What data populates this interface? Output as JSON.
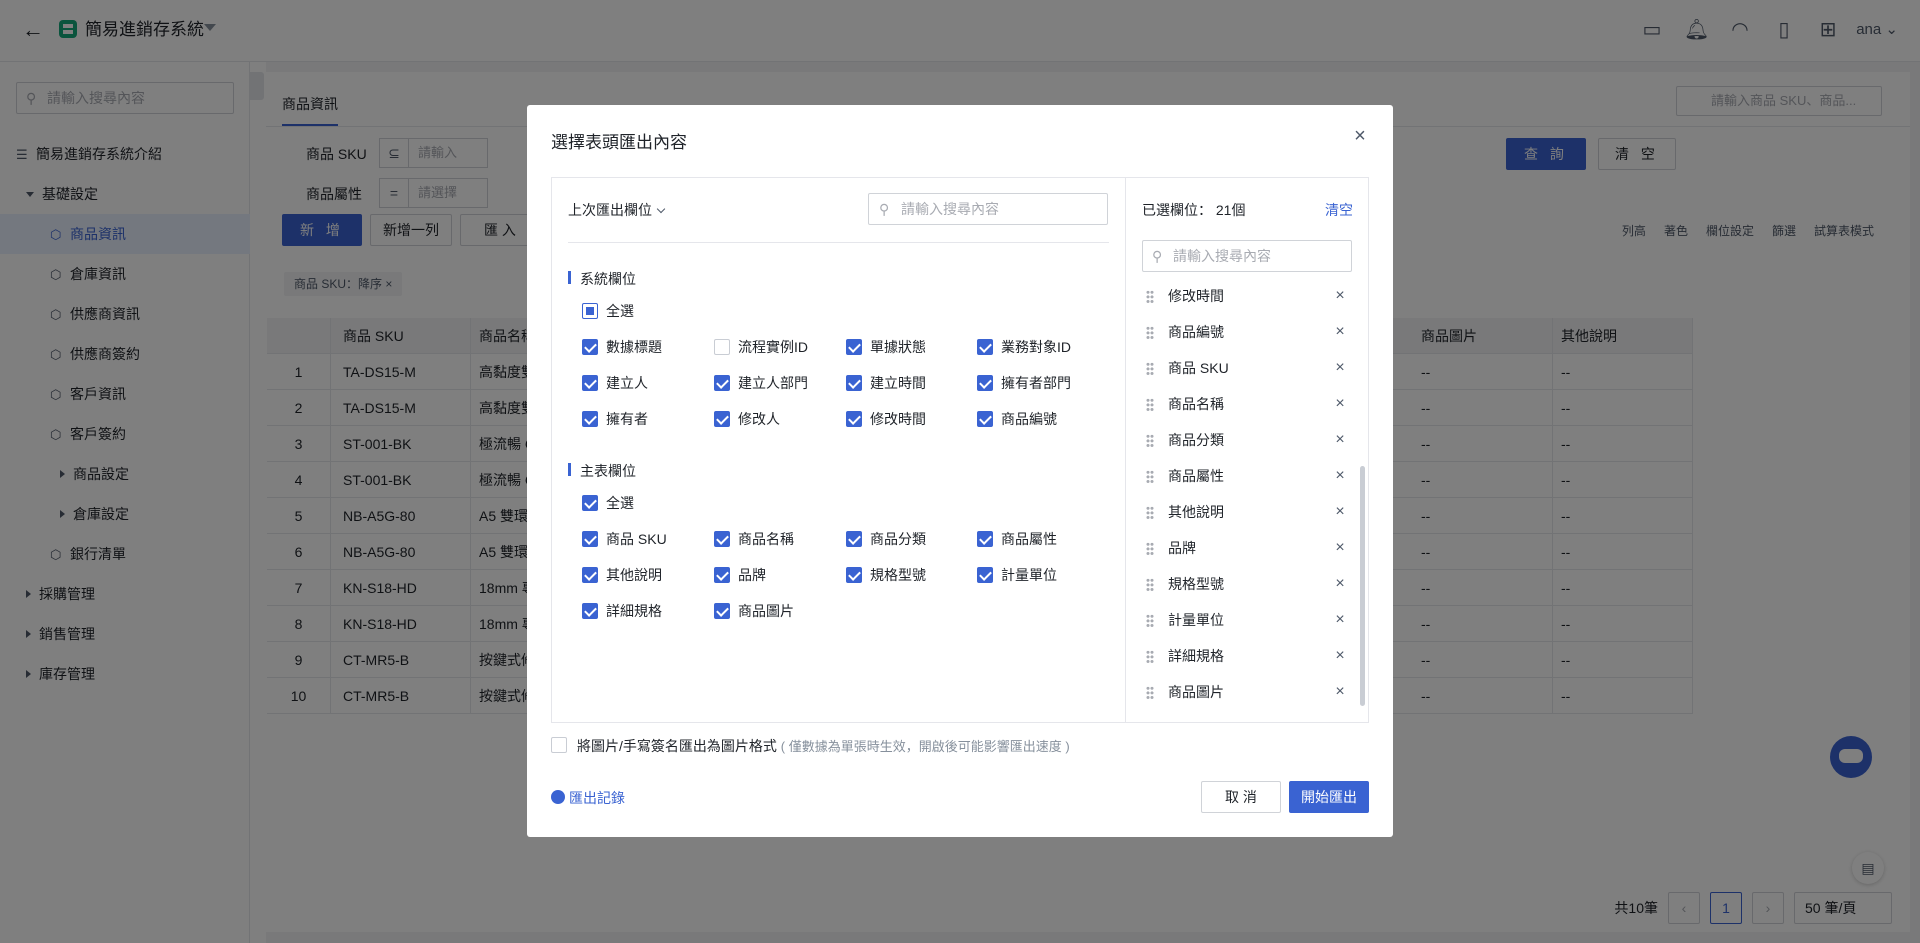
{
  "topbar": {
    "title": "簡易進銷存系統",
    "user": "ana",
    "icons": [
      "monitor-icon",
      "bell-icon",
      "headset-icon",
      "book-icon",
      "add-doc-icon"
    ]
  },
  "sidebar": {
    "search_placeholder": "請輸入搜尋內容",
    "items": [
      {
        "label": "簡易進銷存系統介紹",
        "level": 0,
        "kind": "doc"
      },
      {
        "label": "基礎設定",
        "level": 0,
        "kind": "expanded"
      },
      {
        "label": "商品資訊",
        "level": 1,
        "kind": "cube",
        "active": true
      },
      {
        "label": "倉庫資訊",
        "level": 1,
        "kind": "cube"
      },
      {
        "label": "供應商資訊",
        "level": 1,
        "kind": "cube"
      },
      {
        "label": "供應商簽約",
        "level": 1,
        "kind": "cube"
      },
      {
        "label": "客戶資訊",
        "level": 1,
        "kind": "cube"
      },
      {
        "label": "客戶簽約",
        "level": 1,
        "kind": "cube"
      },
      {
        "label": "商品設定",
        "level": 2,
        "kind": "collapsed"
      },
      {
        "label": "倉庫設定",
        "level": 2,
        "kind": "collapsed"
      },
      {
        "label": "銀行清單",
        "level": 1,
        "kind": "cube"
      },
      {
        "label": "採購管理",
        "level": 0,
        "kind": "collapsed"
      },
      {
        "label": "銷售管理",
        "level": 0,
        "kind": "collapsed"
      },
      {
        "label": "庫存管理",
        "level": 0,
        "kind": "collapsed"
      }
    ]
  },
  "main": {
    "tab": "商品資訊",
    "top_search_placeholder": "請輸入商品 SKU、商品...",
    "filters": [
      {
        "label": "商品 SKU",
        "op": "⊆",
        "placeholder": "請輸入"
      },
      {
        "label": "商品屬性",
        "op": "=",
        "placeholder": "請選擇"
      }
    ],
    "query_label": "查 詢",
    "clear_label": "清 空",
    "actions": {
      "add": "新 增",
      "add_row": "新增一列",
      "import": "匯 入"
    },
    "tools": [
      "列高",
      "著色",
      "欄位設定",
      "篩選",
      "試算表模式"
    ],
    "sort_chip": "商品 SKU：降序",
    "columns": [
      "商品 SKU",
      "商品名稱",
      "商品圖片",
      "其他說明"
    ],
    "rows": [
      {
        "n": "1",
        "sku": "TA-DS15-M",
        "name": "高黏度雙",
        "img": "--",
        "note": "--"
      },
      {
        "n": "2",
        "sku": "TA-DS15-M",
        "name": "高黏度雙",
        "img": "--",
        "note": "--"
      },
      {
        "n": "3",
        "sku": "ST-001-BK",
        "name": "極流暢 C",
        "img": "--",
        "note": "--"
      },
      {
        "n": "4",
        "sku": "ST-001-BK",
        "name": "極流暢 C",
        "img": "--",
        "note": "--"
      },
      {
        "n": "5",
        "sku": "NB-A5G-80",
        "name": "A5 雙環",
        "img": "--",
        "note": "--"
      },
      {
        "n": "6",
        "sku": "NB-A5G-80",
        "name": "A5 雙環",
        "img": "--",
        "note": "--"
      },
      {
        "n": "7",
        "sku": "KN-S18-HD",
        "name": "18mm 專",
        "img": "--",
        "note": "--"
      },
      {
        "n": "8",
        "sku": "KN-S18-HD",
        "name": "18mm 專",
        "img": "--",
        "note": "--"
      },
      {
        "n": "9",
        "sku": "CT-MR5-B",
        "name": "按鍵式修",
        "img": "--",
        "note": "--"
      },
      {
        "n": "10",
        "sku": "CT-MR5-B",
        "name": "按鍵式修",
        "img": "--",
        "note": "--"
      }
    ],
    "pager": {
      "total": "共10筆",
      "page": "1",
      "size": "50 筆/頁"
    }
  },
  "modal": {
    "title": "選擇表頭匯出內容",
    "last_export": "上次匯出欄位",
    "search_placeholder": "請輸入搜尋內容",
    "system_section": "系統欄位",
    "main_section": "主表欄位",
    "select_all": "全選",
    "system_fields": [
      {
        "label": "數據標題",
        "checked": true
      },
      {
        "label": "流程實例ID",
        "checked": false
      },
      {
        "label": "單據狀態",
        "checked": true
      },
      {
        "label": "業務對象ID",
        "checked": true
      },
      {
        "label": "建立人",
        "checked": true
      },
      {
        "label": "建立人部門",
        "checked": true
      },
      {
        "label": "建立時間",
        "checked": true
      },
      {
        "label": "擁有者部門",
        "checked": true
      },
      {
        "label": "擁有者",
        "checked": true
      },
      {
        "label": "修改人",
        "checked": true
      },
      {
        "label": "修改時間",
        "checked": true
      },
      {
        "label": "商品編號",
        "checked": true
      }
    ],
    "main_fields": [
      {
        "label": "商品 SKU",
        "checked": true
      },
      {
        "label": "商品名稱",
        "checked": true
      },
      {
        "label": "商品分類",
        "checked": true
      },
      {
        "label": "商品屬性",
        "checked": true
      },
      {
        "label": "其他說明",
        "checked": true
      },
      {
        "label": "品牌",
        "checked": true
      },
      {
        "label": "規格型號",
        "checked": true
      },
      {
        "label": "計量單位",
        "checked": true
      },
      {
        "label": "詳細規格",
        "checked": true
      },
      {
        "label": "商品圖片",
        "checked": true
      }
    ],
    "selected_count": "已選欄位： 21個",
    "clear": "清空",
    "selected_search_placeholder": "請輸入搜尋內容",
    "selected_fields": [
      "修改時間",
      "商品編號",
      "商品 SKU",
      "商品名稱",
      "商品分類",
      "商品屬性",
      "其他說明",
      "品牌",
      "規格型號",
      "計量單位",
      "詳細規格",
      "商品圖片"
    ],
    "image_option": "將圖片/手寫簽名匯出為圖片格式",
    "image_option_hint": "( 僅數據為單張時生效，開啟後可能影響匯出速度 )",
    "export_log": "匯出記錄",
    "cancel": "取 消",
    "start_export": "開始匯出"
  }
}
